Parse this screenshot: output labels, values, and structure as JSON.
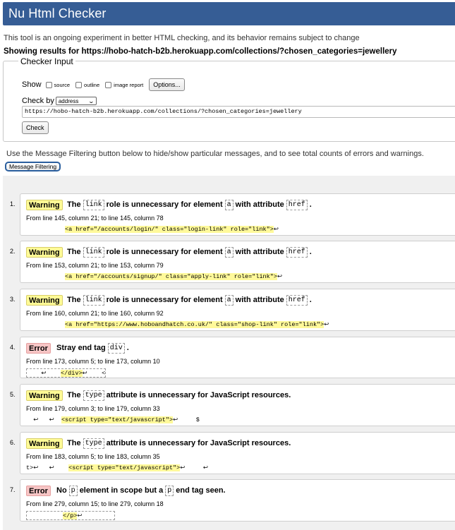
{
  "app": {
    "title": "Nu Html Checker"
  },
  "intro_text": "This tool is an ongoing experiment in better HTML checking, and its behavior remains subject to change",
  "showing_text": "Showing results for https://hobo-hatch-b2b.herokuapp.com/collections/?chosen_categories=jewellery",
  "checker_input": {
    "legend": "Checker Input",
    "show_label": "Show",
    "show_options": [
      "source",
      "outline",
      "image report"
    ],
    "options_button": "Options...",
    "check_by_label": "Check by",
    "check_by_value": "address",
    "url_value": "https://hobo-hatch-b2b.herokuapp.com/collections/?chosen_categories=jewellery",
    "check_button": "Check"
  },
  "filter_hint": "Use the Message Filtering button below to hide/show particular messages, and to see total counts of errors and warnings.",
  "filter_button": "Message Filtering",
  "colors": {
    "header_bg": "#365d95",
    "warning_bg": "#fffa96",
    "error_bg": "#f7c5c5",
    "highlight": "#fff99a"
  },
  "messages": [
    {
      "num": "1.",
      "type": "Warning",
      "parts": [
        "The",
        "link",
        "role is unnecessary for element",
        "a",
        "with attribute",
        "href",
        "."
      ],
      "location": "From line 145, column 21; to line 145, column 78",
      "extract_pre": "",
      "extract_hl": "<a href=\"/accounts/login/\" class=\"login-link\" role=\"link\">",
      "extract_post": "↩"
    },
    {
      "num": "2.",
      "type": "Warning",
      "parts": [
        "The",
        "link",
        "role is unnecessary for element",
        "a",
        "with attribute",
        "href",
        "."
      ],
      "location": "From line 153, column 21; to line 153, column 79",
      "extract_pre": "",
      "extract_hl": "<a href=\"/accounts/signup/\" class=\"apply-link\" role=\"link\">",
      "extract_post": "↩"
    },
    {
      "num": "3.",
      "type": "Warning",
      "parts": [
        "The",
        "link",
        "role is unnecessary for element",
        "a",
        "with attribute",
        "href",
        "."
      ],
      "location": "From line 160, column 21; to line 160, column 92",
      "extract_pre": "",
      "extract_hl": "<a href=\"https://www.hoboandhatch.co.uk/\" class=\"shop-link\" role=\"link\">",
      "extract_post": "↩"
    },
    {
      "num": "4.",
      "type": "Error",
      "parts": [
        "Stray end tag",
        "div",
        "."
      ],
      "location": "From line 173, column 5; to line 173, column 10",
      "extract_pre": "    ↩    ",
      "extract_hl": "</div>",
      "extract_post": "↩    <"
    },
    {
      "num": "5.",
      "type": "Warning",
      "parts": [
        "The",
        "type",
        "attribute is unnecessary for JavaScript resources."
      ],
      "location": "From line 179, column 3; to line 179, column 33",
      "extract_pre": "  ↩   ↩  ",
      "extract_hl": "<script type=\"text/javascript\">",
      "extract_post": "↩     $"
    },
    {
      "num": "6.",
      "type": "Warning",
      "parts": [
        "The",
        "type",
        "attribute is unnecessary for JavaScript resources."
      ],
      "location": "From line 183, column 5; to line 183, column 35",
      "extract_pre": "t>↩   ↩    ",
      "extract_hl": "<script type=\"text/javascript\">",
      "extract_post": "↩     ↩"
    },
    {
      "num": "7.",
      "type": "Error",
      "parts": [
        "No",
        "p",
        "element in scope but a",
        "p",
        "end tag seen."
      ],
      "location": "From line 279, column 15; to line 279, column 18",
      "extract_pre": "          ",
      "extract_hl": "</p>",
      "extract_post": "↩         "
    }
  ]
}
